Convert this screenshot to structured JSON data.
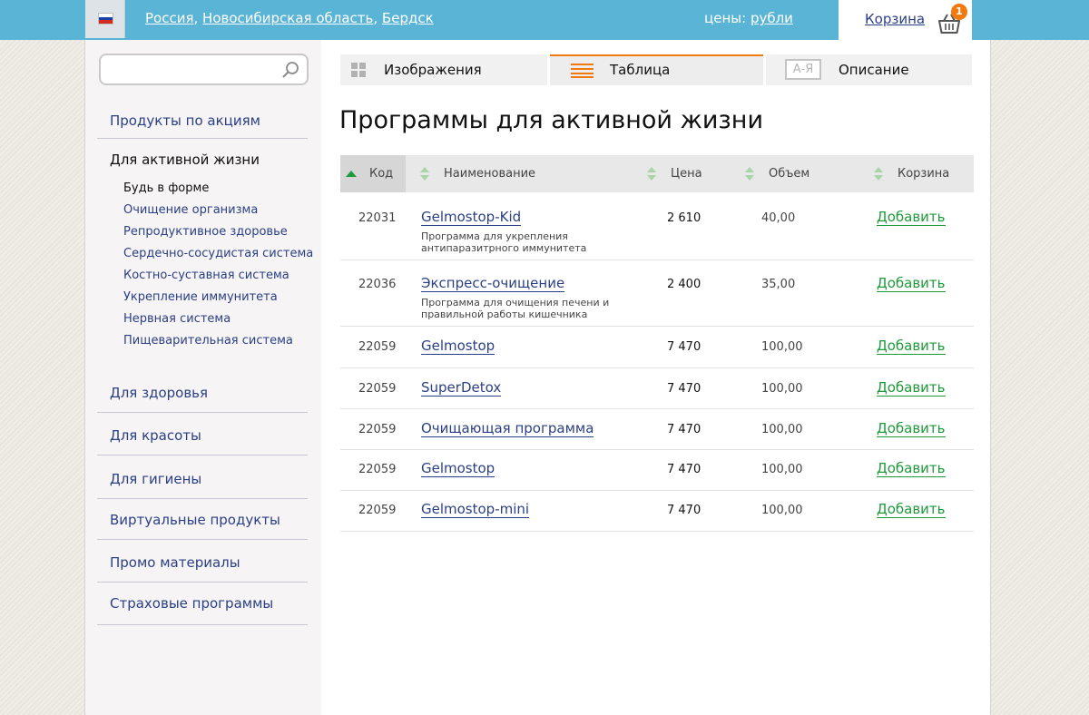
{
  "header": {
    "location": {
      "country": "Россия",
      "region": "Новосибирская область",
      "city": "Бердск"
    },
    "prices_label": "цены:",
    "currency": "рубли",
    "cart_label": "Корзина",
    "cart_count": "1"
  },
  "sidebar": {
    "search_placeholder": "",
    "items_top": [
      {
        "label": "Продукты по акциям"
      },
      {
        "label": "Для активной жизни"
      }
    ],
    "subitems": [
      {
        "label": "Будь в форме"
      },
      {
        "label": "Очищение организма"
      },
      {
        "label": "Репродуктивное здоровье"
      },
      {
        "label": "Сердечно-сосудистая система"
      },
      {
        "label": "Костно-суставная система"
      },
      {
        "label": "Укрепление иммунитета"
      },
      {
        "label": "Нервная система"
      },
      {
        "label": "Пищеварительная система"
      }
    ],
    "items_bottom": [
      {
        "label": "Для здоровья"
      },
      {
        "label": "Для красоты"
      },
      {
        "label": "Для гигиены"
      },
      {
        "label": "Виртуальные продукты"
      },
      {
        "label": "Промо материалы"
      },
      {
        "label": "Страховые программы"
      }
    ]
  },
  "tabs": [
    {
      "label": "Изображения"
    },
    {
      "label": "Таблица"
    },
    {
      "label": "Описание",
      "icon_text": "А-Я"
    }
  ],
  "page_title": "Программы для активной жизни",
  "table": {
    "headers": {
      "code": "Код",
      "name": "Наименование",
      "price": "Цена",
      "volume": "Объем",
      "cart": "Корзина"
    },
    "rows": [
      {
        "code": "22031",
        "name": "Gelmostop-Kid",
        "desc": "Программа для укрепления антипаразитрного иммунитета",
        "price": "2 610",
        "volume": "40,00",
        "action": "Добавить"
      },
      {
        "code": "22036",
        "name": "Экспресс-очищение",
        "desc": "Программа для очищения печени и правильной работы кишечника",
        "price": "2 400",
        "volume": "35,00",
        "action": "Добавить"
      },
      {
        "code": "22059",
        "name": "Gelmostop",
        "desc": "",
        "price": "7 470",
        "volume": "100,00",
        "action": "Добавить"
      },
      {
        "code": "22059",
        "name": "SuperDetox",
        "desc": "",
        "price": "7 470",
        "volume": "100,00",
        "action": "Добавить"
      },
      {
        "code": "22059",
        "name": "Очищающая программа",
        "desc": "",
        "price": "7 470",
        "volume": "100,00",
        "action": "Добавить"
      },
      {
        "code": "22059",
        "name": "Gelmostop",
        "desc": "",
        "price": "7 470",
        "volume": "100,00",
        "action": "Добавить"
      },
      {
        "code": "22059",
        "name": "Gelmostop-mini",
        "desc": "",
        "price": "7 470",
        "volume": "100,00",
        "action": "Добавить"
      }
    ]
  },
  "colors": {
    "topbar": "#5ab4d6",
    "accent": "#f07a10",
    "link": "#2b3f86",
    "add": "#1f9a3a"
  }
}
